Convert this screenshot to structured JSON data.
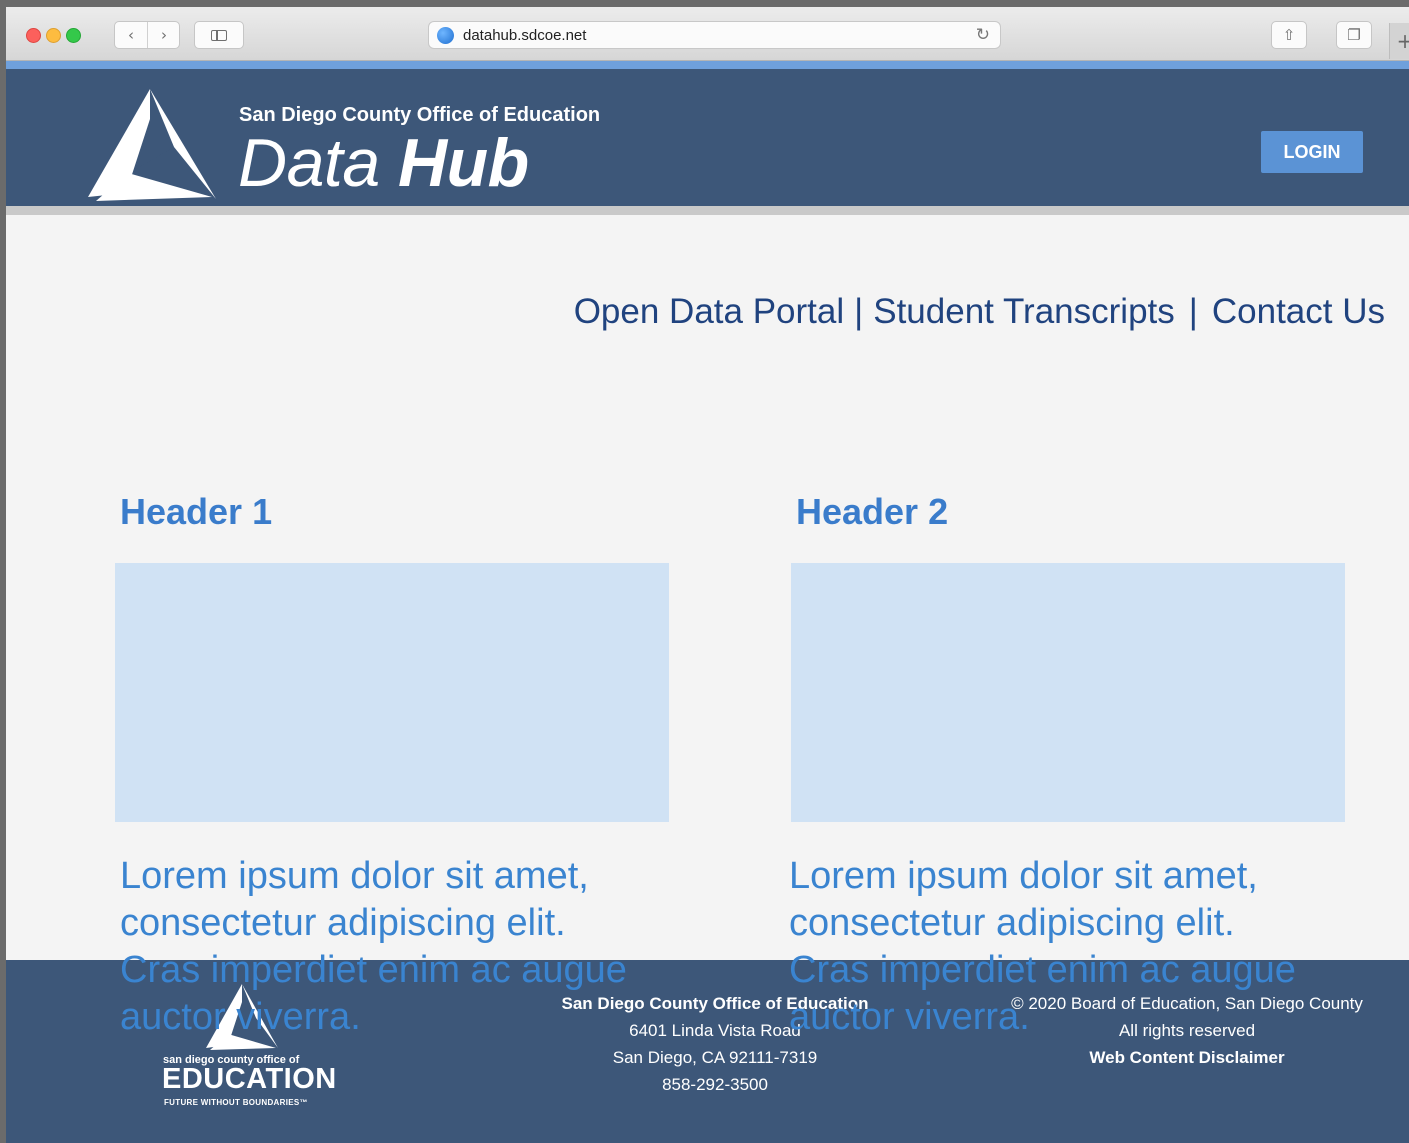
{
  "browser": {
    "url": "datahub.sdcoe.net",
    "back_glyph": "‹",
    "forward_glyph": "›",
    "reload_glyph": "↻",
    "share_glyph": "⇧",
    "tabs_glyph": "❐",
    "newtab_glyph": "+"
  },
  "header": {
    "org_name": "San Diego County Office of Education",
    "title_light": "Data ",
    "title_bold": "Hub",
    "login_label": "LOGIN"
  },
  "nav": {
    "links": [
      "Open Data Portal",
      "Student Transcripts",
      "Contact Us"
    ],
    "separator": "|"
  },
  "columns": [
    {
      "header": "Header 1",
      "text": "Lorem ipsum dolor sit amet, consectetur adipiscing elit. Cras imperdiet enim ac augue auctor viverra."
    },
    {
      "header": "Header 2",
      "text": "Lorem ipsum dolor sit amet, consectetur adipiscing elit. Cras imperdiet enim ac augue auctor viverra."
    }
  ],
  "footer": {
    "logo": {
      "small_text": "san diego county office of",
      "big_text": "EDUCATION",
      "tagline": "FUTURE WITHOUT BOUNDARIES™"
    },
    "address": {
      "org": "San Diego County Office of Education",
      "street": "6401 Linda Vista Road",
      "city": "San Diego, CA 92111-7319",
      "phone": "858-292-3500"
    },
    "copyright": "© 2020 Board of Education, San Diego County",
    "rights": "All rights reserved",
    "disclaimer": "Web Content Disclaimer"
  },
  "colors": {
    "header_bg": "#3d5779",
    "accent": "#6fa0dc",
    "nav_link": "#20437f",
    "column_heading": "#3a7ccb",
    "placeholder_image": "#d0e2f4"
  }
}
